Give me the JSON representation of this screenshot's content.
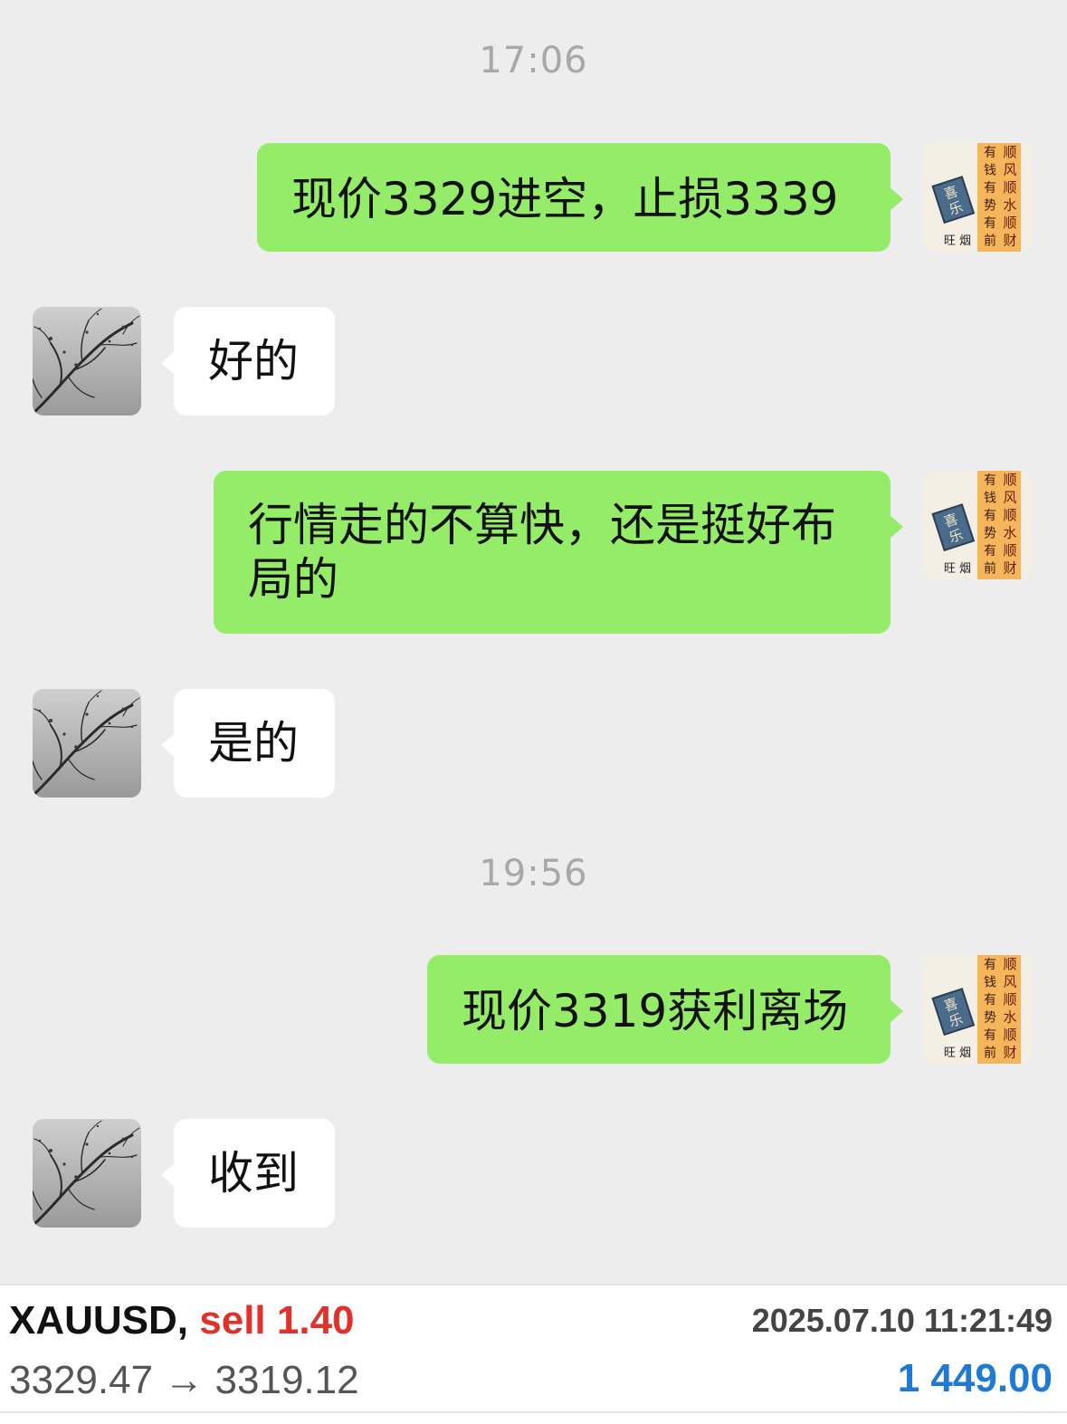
{
  "chat": {
    "timestamp_1": "17:06",
    "timestamp_2": "19:56",
    "messages": [
      {
        "side": "out",
        "text": "现价3329进空，止损3339"
      },
      {
        "side": "in",
        "text": "好的"
      },
      {
        "side": "out",
        "line1": "行情走的不算快，还是挺好布",
        "line2": "局的"
      },
      {
        "side": "in",
        "text": "是的"
      },
      {
        "side": "out",
        "text": "现价3319获利离场"
      },
      {
        "side": "in",
        "text": "收到"
      }
    ],
    "my_avatar": {
      "icon": "calligraphy-avatar-icon",
      "col1": "顺风顺水顺财",
      "col2": "有钱有势有前",
      "stamp": "喜乐",
      "bottom": "旺 烟"
    }
  },
  "trade": {
    "symbol": "XAUUSD,",
    "side": "sell",
    "lots": "1.40",
    "datetime": "2025.07.10 11:21:49",
    "open_price": "3329.47",
    "arrow": "→",
    "close_price": "3319.12",
    "profit": "1 449.00"
  },
  "colors": {
    "background": "#ededed",
    "outgoing_bubble": "#95ec69",
    "incoming_bubble": "#ffffff",
    "sell": "#e0322b",
    "profit": "#1f7ad6"
  }
}
